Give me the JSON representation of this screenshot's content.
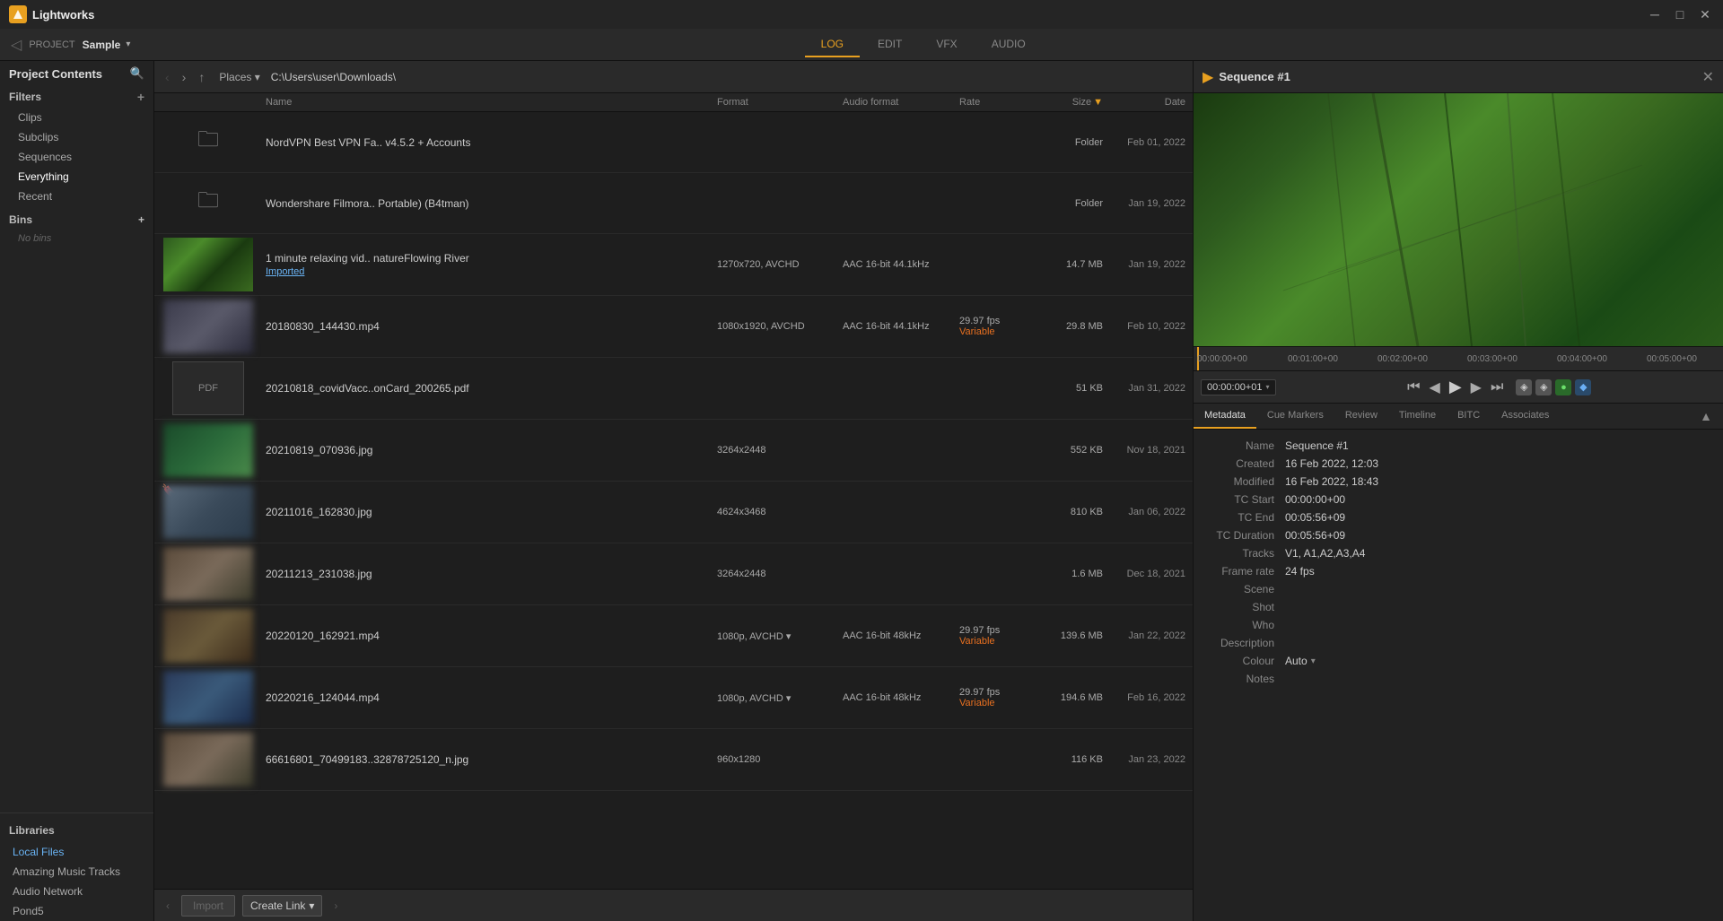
{
  "app": {
    "name": "Lightworks",
    "logo": "LW"
  },
  "titlebar": {
    "minimize": "─",
    "maximize": "□",
    "close": "✕"
  },
  "project": {
    "label": "PROJECT",
    "name": "Sample",
    "dropdown_arrow": "▾"
  },
  "tabs": [
    {
      "id": "log",
      "label": "LOG",
      "active": true
    },
    {
      "id": "edit",
      "label": "EDIT",
      "active": false
    },
    {
      "id": "vfx",
      "label": "VFX",
      "active": false
    },
    {
      "id": "audio",
      "label": "AUDIO",
      "active": false
    }
  ],
  "sidebar": {
    "project_contents_label": "Project Contents",
    "filters_label": "Filters",
    "filter_items": [
      {
        "label": "Clips"
      },
      {
        "label": "Subclips"
      },
      {
        "label": "Sequences"
      },
      {
        "label": "Everything"
      },
      {
        "label": "Recent"
      }
    ],
    "bins_label": "Bins",
    "no_bins": "No bins",
    "libraries_label": "Libraries",
    "library_items": [
      {
        "label": "Local Files",
        "active": true
      },
      {
        "label": "Amazing Music Tracks"
      },
      {
        "label": "Audio Network"
      },
      {
        "label": "Pond5"
      }
    ]
  },
  "file_browser": {
    "places_label": "Places ▾",
    "path": "C:\\Users\\user\\Downloads\\",
    "columns": {
      "name": "Name",
      "format": "Format",
      "audio_format": "Audio format",
      "rate": "Rate",
      "size": "Size",
      "date": "Date"
    },
    "files": [
      {
        "type": "folder",
        "name": "NordVPN Best VPN Fa.. v4.5.2 + Accounts",
        "format": "",
        "audio_format": "",
        "rate": "",
        "size": "Folder",
        "date": "Feb 01, 2022"
      },
      {
        "type": "folder",
        "name": "Wondershare Filmora.. Portable) (B4tman)",
        "format": "",
        "audio_format": "",
        "rate": "",
        "size": "Folder",
        "date": "Jan 19, 2022"
      },
      {
        "type": "video",
        "name": "1 minute relaxing vid.. natureFlowing River",
        "tag": "Imported",
        "format": "1270x720, AVCHD",
        "audio_format": "AAC 16-bit 44.1kHz",
        "rate": "",
        "size": "14.7 MB",
        "date": "Jan 19, 2022",
        "thumb": "nature"
      },
      {
        "type": "video",
        "name": "20180830_144430.mp4",
        "format": "1080x1920, AVCHD",
        "audio_format": "AAC 16-bit 44.1kHz",
        "rate": "29.97 fps",
        "rate_variable": "Variable",
        "size": "29.8 MB",
        "date": "Feb 10, 2022",
        "thumb": "people"
      },
      {
        "type": "pdf",
        "name": "20210818_covidVacc..onCard_200265.pdf",
        "format": "",
        "audio_format": "",
        "rate": "",
        "size": "51 KB",
        "date": "Jan 31, 2022"
      },
      {
        "type": "image",
        "name": "20210819_070936.jpg",
        "format": "3264x2448",
        "audio_format": "",
        "rate": "",
        "size": "552 KB",
        "date": "Nov 18, 2021",
        "thumb": "nature2"
      },
      {
        "type": "image",
        "name": "20211016_162830.jpg",
        "format": "4624x3468",
        "audio_format": "",
        "rate": "",
        "size": "810 KB",
        "date": "Jan 06, 2022",
        "thumb": "outdoor",
        "bookmark": true
      },
      {
        "type": "image",
        "name": "20211213_231038.jpg",
        "format": "3264x2448",
        "audio_format": "",
        "rate": "",
        "size": "1.6 MB",
        "date": "Dec 18, 2021",
        "thumb": "person"
      },
      {
        "type": "video",
        "name": "20220120_162921.mp4",
        "format": "1080p, AVCHD ▾",
        "audio_format": "AAC 16-bit 48kHz",
        "rate": "29.97 fps",
        "rate_variable": "Variable",
        "size": "139.6 MB",
        "date": "Jan 22, 2022",
        "thumb": "video1"
      },
      {
        "type": "video",
        "name": "20220216_124044.mp4",
        "format": "1080p, AVCHD ▾",
        "audio_format": "AAC 16-bit 48kHz",
        "rate": "29.97 fps",
        "rate_variable": "Variable",
        "size": "194.6 MB",
        "date": "Feb 16, 2022",
        "thumb": "video2"
      },
      {
        "type": "image",
        "name": "66616801_70499183..32878725120_n.jpg",
        "format": "960x1280",
        "audio_format": "",
        "rate": "",
        "size": "116 KB",
        "date": "Jan 23, 2022",
        "thumb": "person2"
      }
    ],
    "import_btn": "Import",
    "create_link_btn": "Create Link",
    "create_link_arrow": "▾"
  },
  "sequence_viewer": {
    "title": "Sequence #1",
    "close": "✕",
    "timecode": "00:00:00+00",
    "tc_display": "00:00:00+01",
    "tc_arrow": "▾",
    "timeline_markers": [
      "00:00:00+00",
      "00:01:00+00",
      "00:02:00+00",
      "00:03:00+00",
      "00:04:00+00",
      "00:05:00+00"
    ],
    "metadata_tabs": [
      {
        "id": "metadata",
        "label": "Metadata",
        "active": true
      },
      {
        "id": "cue_markers",
        "label": "Cue Markers"
      },
      {
        "id": "review",
        "label": "Review"
      },
      {
        "id": "timeline",
        "label": "Timeline"
      },
      {
        "id": "bitc",
        "label": "BITC"
      },
      {
        "id": "associates",
        "label": "Associates"
      }
    ],
    "metadata": {
      "name_label": "Name",
      "name_value": "Sequence #1",
      "created_label": "Created",
      "created_value": "16 Feb 2022, 12:03",
      "modified_label": "Modified",
      "modified_value": "16 Feb 2022, 18:43",
      "tc_start_label": "TC Start",
      "tc_start_value": "00:00:00+00",
      "tc_end_label": "TC End",
      "tc_end_value": "00:05:56+09",
      "tc_duration_label": "TC Duration",
      "tc_duration_value": "00:05:56+09",
      "tracks_label": "Tracks",
      "tracks_value": "V1, A1,A2,A3,A4",
      "frame_rate_label": "Frame rate",
      "frame_rate_value": "24 fps",
      "scene_label": "Scene",
      "scene_value": "",
      "shot_label": "Shot",
      "shot_value": "",
      "who_label": "Who",
      "who_value": "",
      "description_label": "Description",
      "description_value": "",
      "colour_label": "Colour",
      "colour_value": "Auto",
      "colour_arrow": "▾",
      "notes_label": "Notes",
      "notes_value": ""
    }
  }
}
